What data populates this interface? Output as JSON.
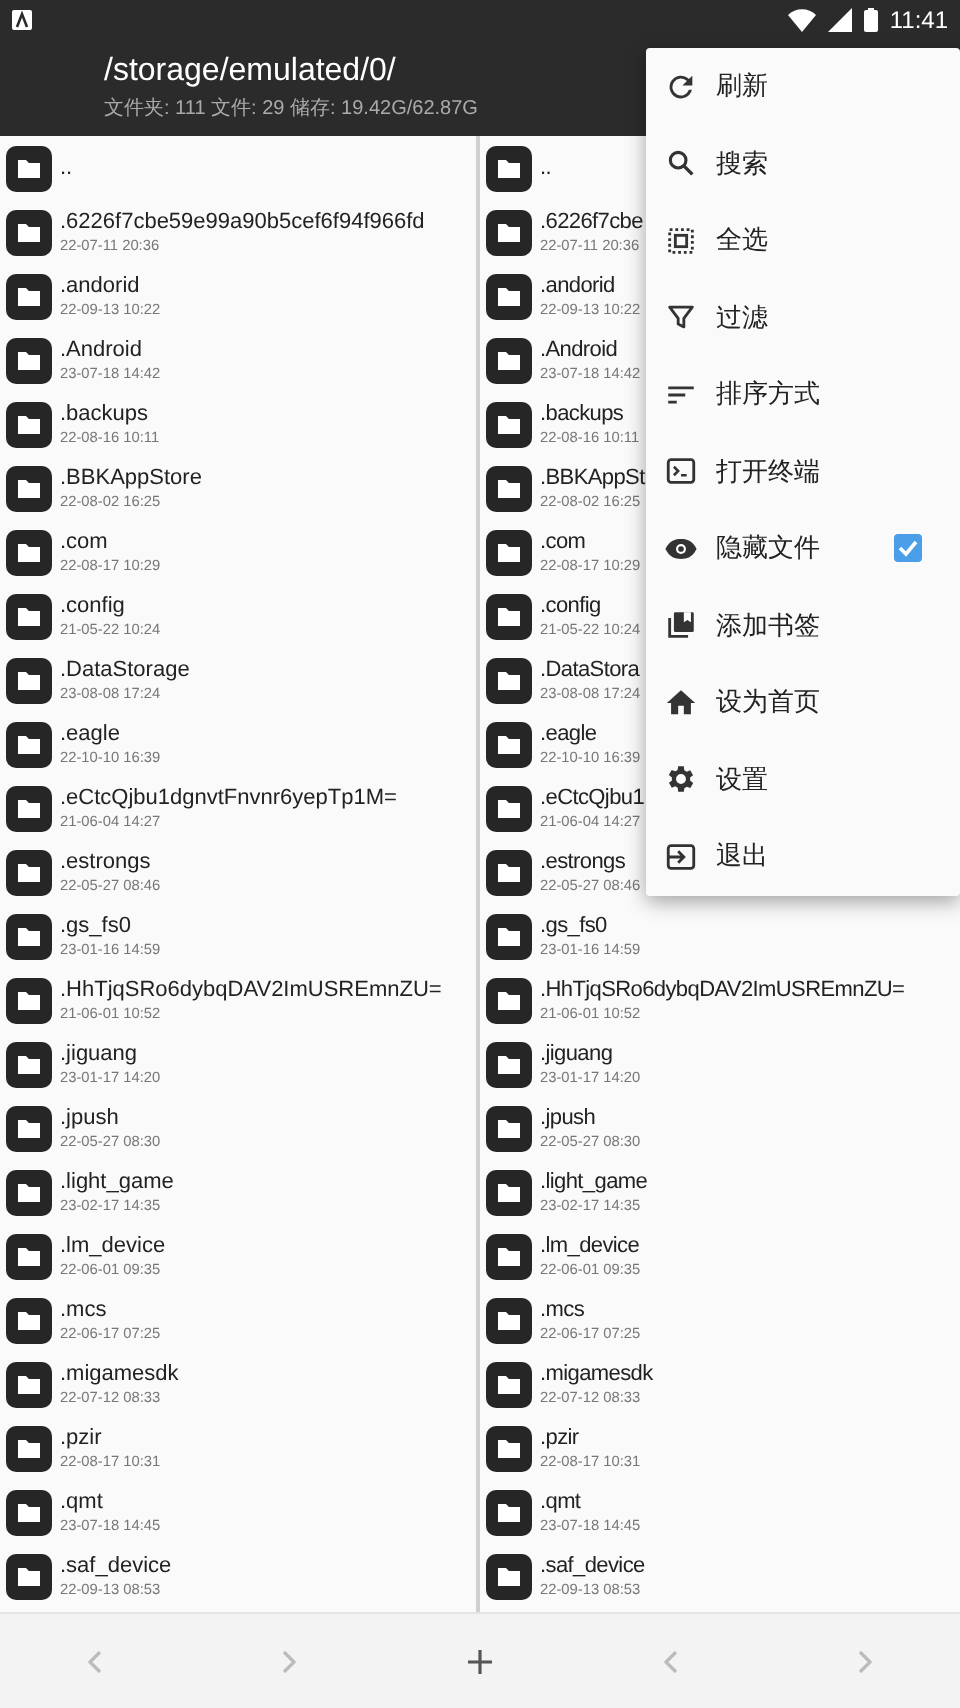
{
  "status_bar": {
    "time": "11:41"
  },
  "header": {
    "path": "/storage/emulated/0/",
    "info": "文件夹: 111  文件: 29  储存: 19.42G/62.87G"
  },
  "left_pane": {
    "rows": [
      {
        "name": ".."
      },
      {
        "name": ".6226f7cbe59e99a90b5cef6f94f966fd",
        "date": "22-07-11 20:36"
      },
      {
        "name": ".andorid",
        "date": "22-09-13 10:22"
      },
      {
        "name": ".Android",
        "date": "23-07-18 14:42"
      },
      {
        "name": ".backups",
        "date": "22-08-16 10:11"
      },
      {
        "name": ".BBKAppStore",
        "date": "22-08-02 16:25"
      },
      {
        "name": ".com",
        "date": "22-08-17 10:29"
      },
      {
        "name": ".config",
        "date": "21-05-22 10:24"
      },
      {
        "name": ".DataStorage",
        "date": "23-08-08 17:24"
      },
      {
        "name": ".eagle",
        "date": "22-10-10 16:39"
      },
      {
        "name": ".eCtcQjbu1dgnvtFnvnr6yepTp1M=",
        "date": "21-06-04 14:27"
      },
      {
        "name": ".estrongs",
        "date": "22-05-27 08:46"
      },
      {
        "name": ".gs_fs0",
        "date": "23-01-16 14:59"
      },
      {
        "name": ".HhTjqSRo6dybqDAV2ImUSREmnZU=",
        "date": "21-06-01 10:52"
      },
      {
        "name": ".jiguang",
        "date": "23-01-17 14:20"
      },
      {
        "name": ".jpush",
        "date": "22-05-27 08:30"
      },
      {
        "name": ".light_game",
        "date": "23-02-17 14:35"
      },
      {
        "name": ".lm_device",
        "date": "22-06-01 09:35"
      },
      {
        "name": ".mcs",
        "date": "22-06-17 07:25"
      },
      {
        "name": ".migamesdk",
        "date": "22-07-12 08:33"
      },
      {
        "name": ".pzir",
        "date": "22-08-17 10:31"
      },
      {
        "name": ".qmt",
        "date": "23-07-18 14:45"
      },
      {
        "name": ".saf_device",
        "date": "22-09-13 08:53"
      }
    ]
  },
  "right_pane": {
    "rows": [
      {
        "name": ".."
      },
      {
        "name": ".6226f7cbe",
        "date": "22-07-11 20:36"
      },
      {
        "name": ".andorid",
        "date": "22-09-13 10:22"
      },
      {
        "name": ".Android",
        "date": "23-07-18 14:42"
      },
      {
        "name": ".backups",
        "date": "22-08-16 10:11"
      },
      {
        "name": ".BBKAppSt",
        "date": "22-08-02 16:25"
      },
      {
        "name": ".com",
        "date": "22-08-17 10:29"
      },
      {
        "name": ".config",
        "date": "21-05-22 10:24"
      },
      {
        "name": ".DataStora",
        "date": "23-08-08 17:24"
      },
      {
        "name": ".eagle",
        "date": "22-10-10 16:39"
      },
      {
        "name": ".eCtcQjbu1",
        "date": "21-06-04 14:27"
      },
      {
        "name": ".estrongs",
        "date": "22-05-27 08:46"
      },
      {
        "name": ".gs_fs0",
        "date": "23-01-16 14:59"
      },
      {
        "name": ".HhTjqSRo6dybqDAV2ImUSREmnZU=",
        "date": "21-06-01 10:52"
      },
      {
        "name": ".jiguang",
        "date": "23-01-17 14:20"
      },
      {
        "name": ".jpush",
        "date": "22-05-27 08:30"
      },
      {
        "name": ".light_game",
        "date": "23-02-17 14:35"
      },
      {
        "name": ".lm_device",
        "date": "22-06-01 09:35"
      },
      {
        "name": ".mcs",
        "date": "22-06-17 07:25"
      },
      {
        "name": ".migamesdk",
        "date": "22-07-12 08:33"
      },
      {
        "name": ".pzir",
        "date": "22-08-17 10:31"
      },
      {
        "name": ".qmt",
        "date": "23-07-18 14:45"
      },
      {
        "name": ".saf_device",
        "date": "22-09-13 08:53"
      }
    ]
  },
  "menu": {
    "items": [
      {
        "label": "刷新",
        "kind": "plain"
      },
      {
        "label": "搜索",
        "kind": "plain"
      },
      {
        "label": "全选",
        "kind": "plain"
      },
      {
        "label": "过滤",
        "kind": "plain"
      },
      {
        "label": "排序方式",
        "kind": "plain"
      },
      {
        "label": "打开终端",
        "kind": "plain"
      },
      {
        "label": "隐藏文件",
        "kind": "check",
        "checked": true
      },
      {
        "label": "添加书签",
        "kind": "plain"
      },
      {
        "label": "设为首页",
        "kind": "plain"
      },
      {
        "label": "设置",
        "kind": "plain"
      },
      {
        "label": "退出",
        "kind": "plain"
      }
    ]
  }
}
